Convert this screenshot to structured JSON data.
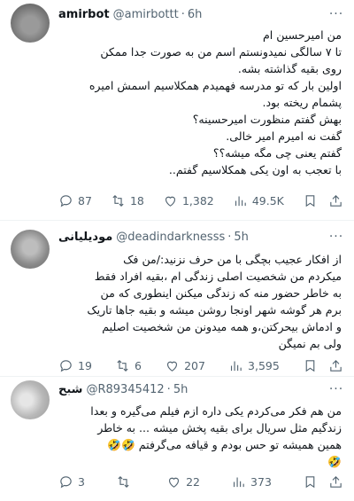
{
  "tweets": [
    {
      "display_name": "amirbot",
      "handle": "@amirbottt",
      "separator": "·",
      "time": "6h",
      "text_lines": [
        "من امیرحسین ام",
        "تا ۷ سالگی نمیدونستم اسم من به صورت جدا ممکن",
        "روی بقیه گذاشته بشه.",
        "اولین بار که تو مدرسه فهمیدم همکلاسیم اسمش امیره",
        "پشمام ریخته بود.",
        "بهش گفتم منظورت امیرحسینه؟",
        "گفت نه امیرم امیر خالی.",
        "گفتم یعنی چی مگه میشه؟؟",
        "با تعجب به اون یکی همکلاسیم گفتم.."
      ],
      "replies": "87",
      "retweets": "18",
      "likes": "1,382",
      "views": "49.5K"
    },
    {
      "display_name": "مودیلیانی",
      "handle": "@deadindarknesss",
      "separator": "·",
      "time": "5h",
      "text_lines": [
        "از افکار عجیب بچگی با من حرف نزنید:/من فک",
        "میکردم من شخصیت اصلی زندگی ام ،بقیه افراد فقط",
        "به خاطر حضور منه که زندگی میکنن اینطوری که من",
        "برم هر گوشه شهر اونجا روشن میشه و بقیه جاها تاریک",
        "و ادماش بیحرکتن،و همه میدونن من شخصیت اصلیم",
        "ولی بم نمیگن"
      ],
      "replies": "19",
      "retweets": "6",
      "likes": "207",
      "views": "3,595"
    },
    {
      "display_name": "شبح",
      "handle": "@R89345412",
      "separator": "·",
      "time": "5h",
      "text_lines": [
        "من هم فکر می‌کردم یکی داره ازم فیلم می‌گیره و بعدا",
        "زندگیم مثل سریال برای بقیه پخش میشه ... به خاطر",
        "همین همیشه تو حس بودم و قیافه می‌گرفتم 🤣🤣",
        "🤣"
      ],
      "replies": "3",
      "retweets": "",
      "likes": "22",
      "views": "373"
    }
  ],
  "icons": {
    "reply": "reply-icon",
    "retweet": "retweet-icon",
    "like": "heart-icon",
    "views": "views-icon",
    "bookmark": "bookmark-icon",
    "share": "share-icon",
    "more": "more-icon"
  },
  "colors": {
    "text": "#0f1419",
    "secondary": "#536471",
    "divider": "#eff3f4"
  }
}
